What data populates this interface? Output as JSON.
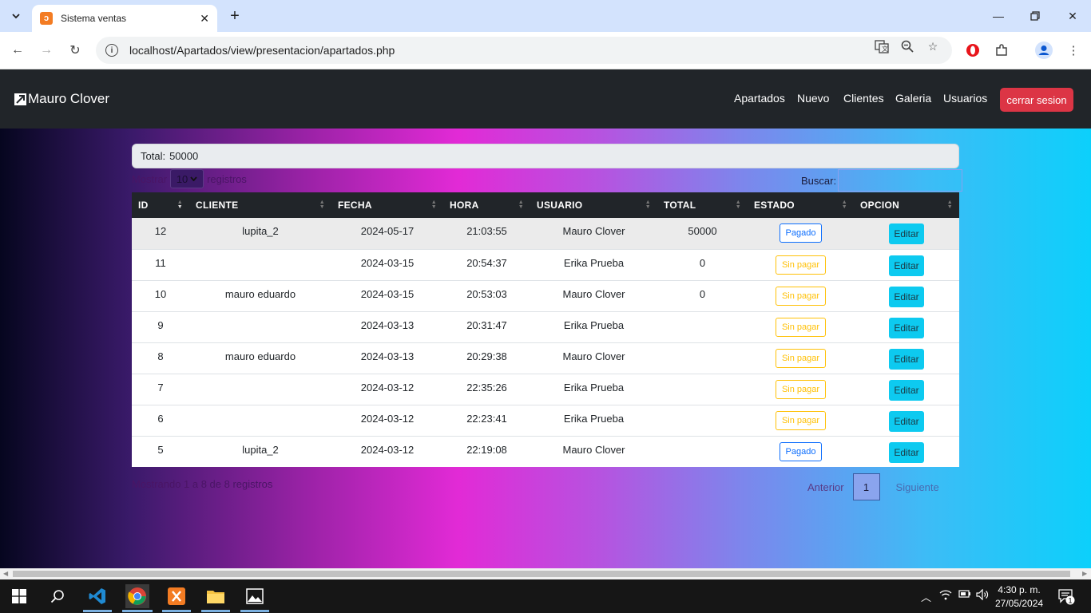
{
  "browser": {
    "tab_title": "Sistema ventas",
    "url": "localhost/Apartados/view/presentacion/apartados.php"
  },
  "app": {
    "brand": "Mauro Clover",
    "nav": [
      "Apartados",
      "Nuevo",
      "Clientes",
      "Galeria",
      "Usuarios"
    ],
    "logout_label": "cerrar sesion"
  },
  "summary": {
    "total_label": "Total:",
    "total_value": "50000"
  },
  "datatable": {
    "length_prefix": "Mostrar",
    "length_value": "10",
    "length_suffix": "registros",
    "search_label": "Buscar:",
    "columns": [
      "ID",
      "CLIENTE",
      "FECHA",
      "HORA",
      "USUARIO",
      "TOTAL",
      "ESTADO",
      "OPCION"
    ],
    "rows": [
      {
        "id": "12",
        "cliente": "lupita_2",
        "fecha": "2024-05-17",
        "hora": "21:03:55",
        "usuario": "Mauro Clover",
        "total": "50000",
        "estado": "Pagado",
        "opcion": "Editar"
      },
      {
        "id": "11",
        "cliente": "",
        "fecha": "2024-03-15",
        "hora": "20:54:37",
        "usuario": "Erika Prueba",
        "total": "0",
        "estado": "Sin pagar",
        "opcion": "Editar"
      },
      {
        "id": "10",
        "cliente": "mauro eduardo",
        "fecha": "2024-03-15",
        "hora": "20:53:03",
        "usuario": "Mauro Clover",
        "total": "0",
        "estado": "Sin pagar",
        "opcion": "Editar"
      },
      {
        "id": "9",
        "cliente": "",
        "fecha": "2024-03-13",
        "hora": "20:31:47",
        "usuario": "Erika Prueba",
        "total": "",
        "estado": "Sin pagar",
        "opcion": "Editar"
      },
      {
        "id": "8",
        "cliente": "mauro eduardo",
        "fecha": "2024-03-13",
        "hora": "20:29:38",
        "usuario": "Mauro Clover",
        "total": "",
        "estado": "Sin pagar",
        "opcion": "Editar"
      },
      {
        "id": "7",
        "cliente": "",
        "fecha": "2024-03-12",
        "hora": "22:35:26",
        "usuario": "Erika Prueba",
        "total": "",
        "estado": "Sin pagar",
        "opcion": "Editar"
      },
      {
        "id": "6",
        "cliente": "",
        "fecha": "2024-03-12",
        "hora": "22:23:41",
        "usuario": "Erika Prueba",
        "total": "",
        "estado": "Sin pagar",
        "opcion": "Editar"
      },
      {
        "id": "5",
        "cliente": "lupita_2",
        "fecha": "2024-03-12",
        "hora": "22:19:08",
        "usuario": "Mauro Clover",
        "total": "",
        "estado": "Pagado",
        "opcion": "Editar"
      }
    ],
    "info": "Mostrando 1 a 8 de 8 registros",
    "prev_label": "Anterior",
    "current_page": "1",
    "next_label": "Siguiente"
  },
  "taskbar": {
    "time": "4:30 p. m.",
    "date": "27/05/2024",
    "notifications": "1"
  },
  "colors": {
    "navbar": "#212529",
    "danger": "#dc3545",
    "info": "#0dcaf0",
    "primary": "#0d6efd",
    "warning": "#ffc107"
  }
}
